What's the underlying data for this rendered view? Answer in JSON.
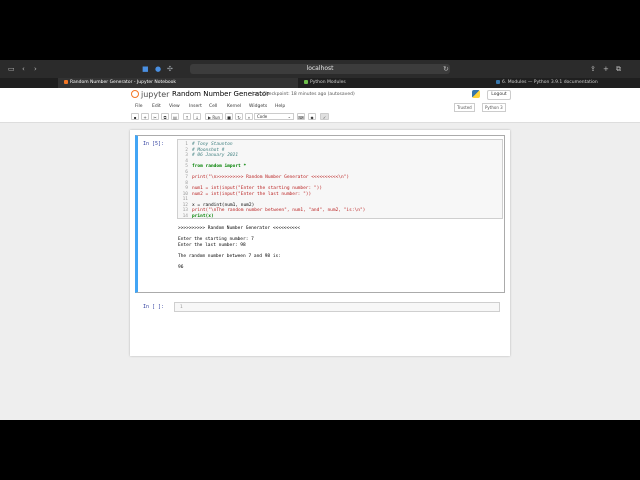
{
  "browser": {
    "address": "localhost",
    "tabs": [
      {
        "label": "Random Number Generator - Jupyter Notebook",
        "active": true
      },
      {
        "label": "Python Modules",
        "active": false
      },
      {
        "label": "6. Modules — Python 3.9.1 documentation",
        "active": false
      }
    ]
  },
  "header": {
    "logo_text": "jupyter",
    "notebook_title": "Random Number Generator",
    "checkpoint": "Last Checkpoint: 18 minutes ago  (autosaved)",
    "logout_label": "Logout"
  },
  "menubar": {
    "items": [
      "File",
      "Edit",
      "View",
      "Insert",
      "Cell",
      "Kernel",
      "Widgets",
      "Help"
    ],
    "trusted": "Trusted",
    "kernel": "Python 3"
  },
  "toolbar": {
    "run_label": "Run",
    "cell_type": "Code"
  },
  "cell1": {
    "prompt": "In [5]:",
    "lines": [
      {
        "n": "1",
        "text": "# Tony Staunton"
      },
      {
        "n": "2",
        "text": "# Moonshot #"
      },
      {
        "n": "3",
        "text": "# 06 January 2021"
      },
      {
        "n": "4",
        "text": ""
      },
      {
        "n": "5",
        "text": "from random import *"
      },
      {
        "n": "6",
        "text": ""
      },
      {
        "n": "7",
        "text": "print(\"\\n>>>>>>>>>> Random Number Generator <<<<<<<<<<\\n\")"
      },
      {
        "n": "8",
        "text": ""
      },
      {
        "n": "9",
        "text": "num1 = int(input(\"Enter the starting number: \"))"
      },
      {
        "n": "10",
        "text": "num2 = int(input(\"Enter the last number: \"))"
      },
      {
        "n": "11",
        "text": ""
      },
      {
        "n": "12",
        "text": "x = randint(num1, num2)"
      },
      {
        "n": "13",
        "text": "print(\"\\nThe random number between\", num1, \"and\", num2, \"is:\\n\")"
      },
      {
        "n": "14",
        "text": "print(x)"
      }
    ],
    "output": [
      ">>>>>>>>>> Random Number Generator <<<<<<<<<<",
      "",
      "Enter the starting number: 7",
      "Enter the last number: 98",
      "",
      "The random number between 7 and 98 is:",
      "",
      "96"
    ]
  },
  "cell2": {
    "prompt": "In [ ]:",
    "line_number": "1"
  }
}
